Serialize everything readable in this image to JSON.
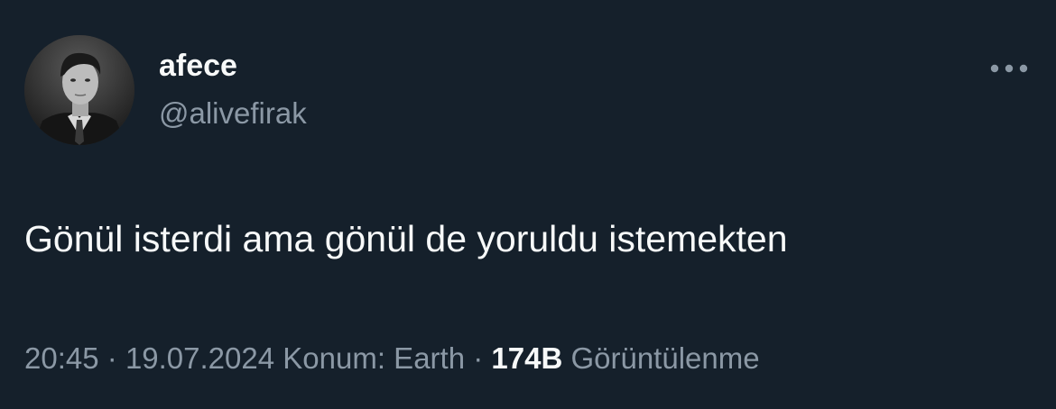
{
  "tweet": {
    "author": {
      "display_name": "afece",
      "handle": "@alivefirak",
      "avatar_icon": "profile-photo"
    },
    "text": "Gönül isterdi ama gönül de yoruldu istemekten",
    "time": "20:45",
    "separator": "·",
    "date": "19.07.2024",
    "location": "Konum: Earth",
    "views_count": "174B",
    "views_label": "Görüntülenme",
    "more_icon": "more-horizontal-icon"
  },
  "colors": {
    "background": "#15202b",
    "primary_text": "#f7f9f9",
    "secondary_text": "#8b98a5"
  }
}
